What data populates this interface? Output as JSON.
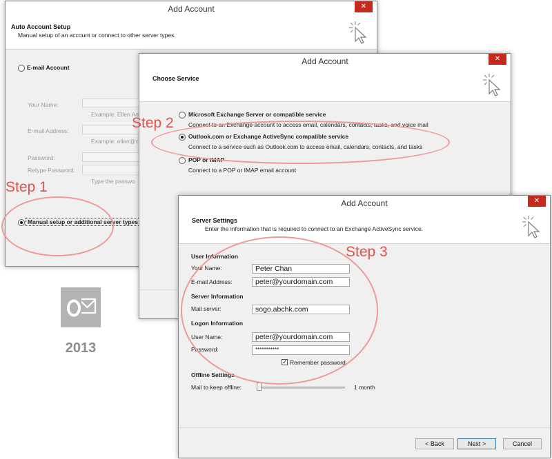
{
  "window1": {
    "title": "Add Account",
    "header_title": "Auto Account Setup",
    "header_sub": "Manual setup of an account or connect to other server types.",
    "email_account_label": "E-mail Account",
    "your_name_label": "Your Name:",
    "name_example": "Example: Ellen Ad",
    "email_label": "E-mail Address:",
    "email_example": "Example: ellen@c",
    "password_label": "Password:",
    "retype_label": "Retype Password:",
    "password_hint": "Type the passwo",
    "manual_setup_label": "Manual setup or additional server types"
  },
  "window2": {
    "title": "Add Account",
    "header_title": "Choose Service",
    "option1_label": "Microsoft Exchange Server or compatible service",
    "option1_desc": "Connect to an Exchange account to access email, calendars, contacts, tasks, and voice mail",
    "option2_label": "Outlook.com or Exchange ActiveSync compatible service",
    "option2_desc": "Connect to a service such as Outlook.com to access email, calendars, contacts, and tasks",
    "option3_label": "POP or IMAP",
    "option3_desc": "Connect to a POP or IMAP email account"
  },
  "window3": {
    "title": "Add Account",
    "header_title": "Server Settings",
    "header_sub": "Enter the information that is required to connect to an Exchange ActiveSync service.",
    "user_info_heading": "User Information",
    "your_name_label": "Your Name:",
    "your_name_value": "Peter Chan",
    "email_label": "E-mail Address:",
    "email_value": "peter@yourdomain.com",
    "server_info_heading": "Server Information",
    "mail_server_label": "Mail server:",
    "mail_server_value": "sogo.abchk.com",
    "logon_heading": "Logon Information",
    "user_name_label": "User Name:",
    "user_name_value": "peter@yourdomain.com",
    "password_label": "Password:",
    "password_value": "***********",
    "remember_label": "Remember password",
    "offline_heading": "Offline Settings",
    "offline_label": "Mail to keep offline:",
    "offline_value": "1 month",
    "back_button": "< Back",
    "next_button": "Next >",
    "cancel_button": "Cancel"
  },
  "annotations": {
    "step1": "Step 1",
    "step2": "Step 2",
    "step3": "Step 3"
  },
  "logo": {
    "icon": "outlook-icon",
    "year": "2013"
  },
  "colors": {
    "annotation": "#e0504d",
    "close_button": "#c42b1c",
    "logo_gray": "#b3b3b3"
  }
}
